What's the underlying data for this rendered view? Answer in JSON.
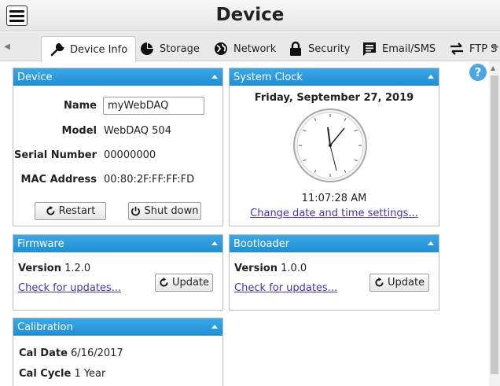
{
  "header": {
    "title": "Device"
  },
  "tabs": [
    {
      "label": "Device Info",
      "icon": "wrench-icon",
      "active": true
    },
    {
      "label": "Storage",
      "icon": "pie-chart-icon"
    },
    {
      "label": "Network",
      "icon": "globe-icon"
    },
    {
      "label": "Security",
      "icon": "lock-icon"
    },
    {
      "label": "Email/SMS",
      "icon": "message-icon"
    },
    {
      "label": "FTP S",
      "icon": "transfer-icon"
    }
  ],
  "device_panel": {
    "title": "Device",
    "name_label": "Name",
    "name_value": "myWebDAQ",
    "model_label": "Model",
    "model_value": "WebDAQ 504",
    "serial_label": "Serial Number",
    "serial_value": "00000000",
    "mac_label": "MAC Address",
    "mac_value": "00:80:2F:FF:FF:FD",
    "restart_label": "Restart",
    "shutdown_label": "Shut down"
  },
  "clock_panel": {
    "title": "System Clock",
    "date": "Friday, September 27, 2019",
    "time": "11:07:28 AM",
    "change_link": "Change date and time settings..."
  },
  "firmware_panel": {
    "title": "Firmware",
    "version_label": "Version",
    "version_value": "1.2.0",
    "check_link": "Check for updates...",
    "update_label": "Update"
  },
  "bootloader_panel": {
    "title": "Bootloader",
    "version_label": "Version",
    "version_value": "1.0.0",
    "check_link": "Check for updates...",
    "update_label": "Update"
  },
  "calibration_panel": {
    "title": "Calibration",
    "date_label": "Cal Date",
    "date_value": "6/16/2017",
    "cycle_label": "Cal Cycle",
    "cycle_value": "1 Year"
  },
  "help": {
    "label": "?"
  },
  "colors": {
    "panel_header": "#2a99dc",
    "link": "#4433aa"
  }
}
